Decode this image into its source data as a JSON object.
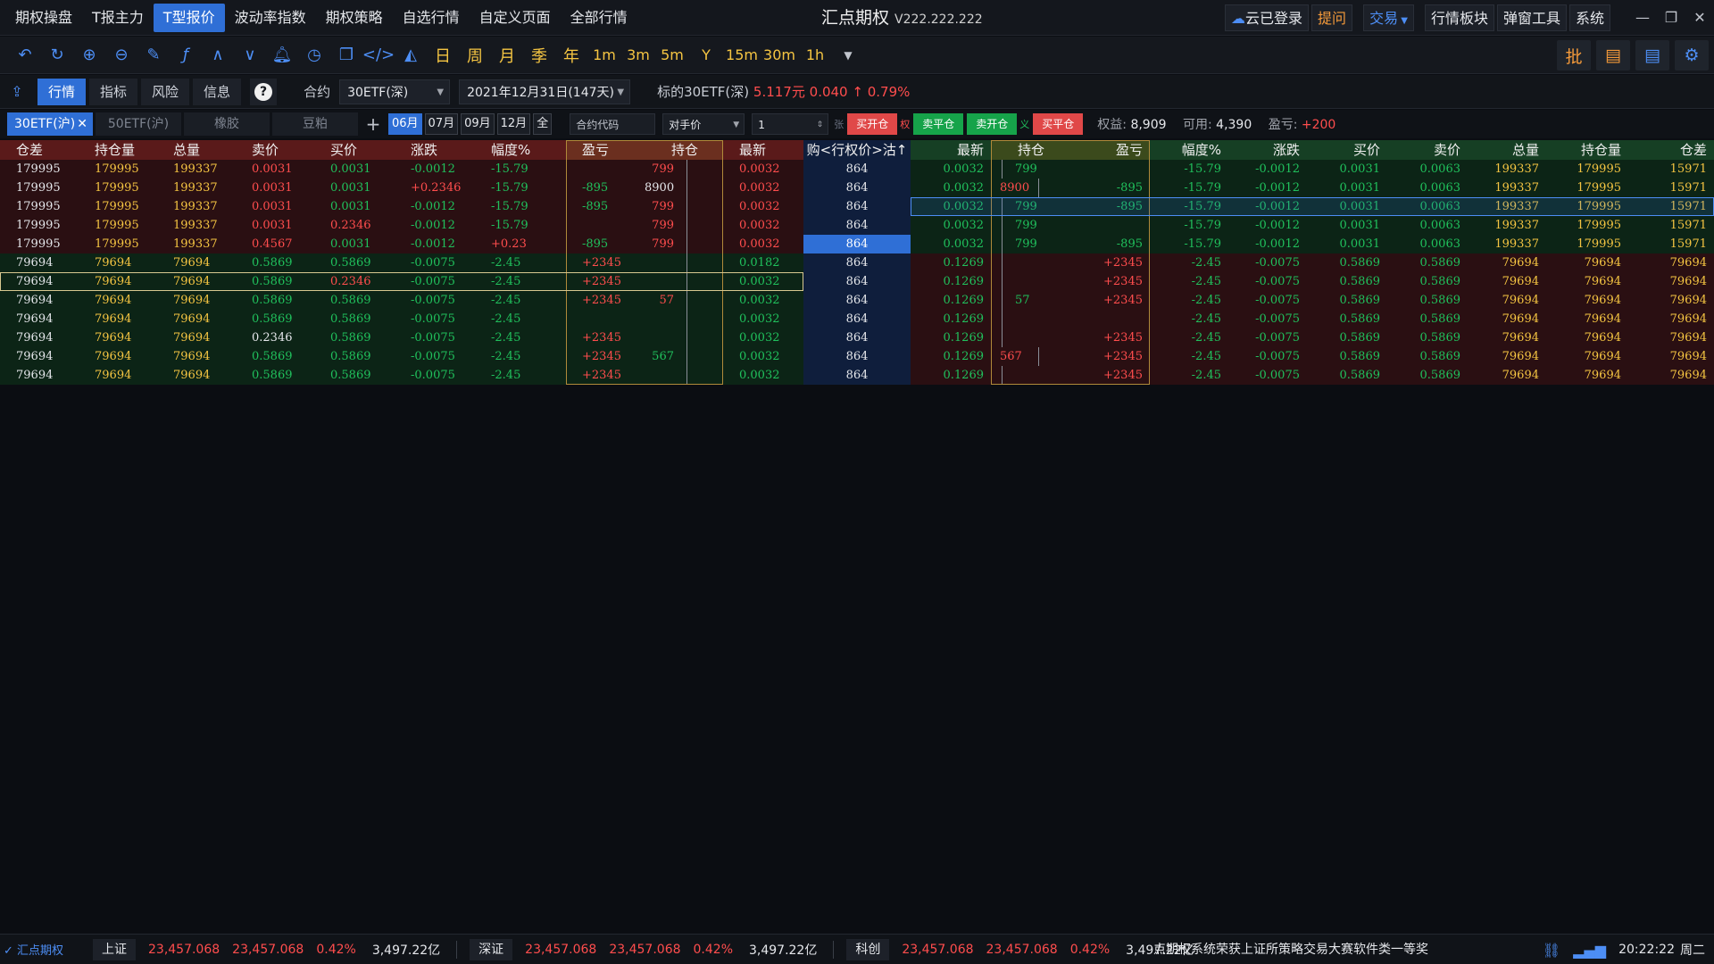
{
  "menu": [
    "期权操盘",
    "T报主力",
    "T型报价",
    "波动率指数",
    "期权策略",
    "自选行情",
    "自定义页面",
    "全部行情"
  ],
  "menu_active": 2,
  "app": {
    "title": "汇点期权",
    "version": "V222.222.222"
  },
  "title_buttons": {
    "cloud": "云已登录",
    "ask": "提问",
    "trade": "交易",
    "board": "行情板块",
    "popup": "弹窗工具",
    "system": "系统"
  },
  "toolbar_text": {
    "day": "日",
    "week": "周",
    "month": "月",
    "quarter": "季",
    "year": "年",
    "m1": "1m",
    "m3": "3m",
    "m5": "5m",
    "y": "Y",
    "m15": "15m",
    "m30": "30m",
    "h1": "1h",
    "batch": "批"
  },
  "infobar": {
    "tabs": [
      "行情",
      "指标",
      "风险",
      "信息"
    ],
    "contract_label": "合约",
    "contract": "30ETF(深)",
    "expiry": "2021年12月31日(147天)",
    "underlying_label": "标的30ETF(深)",
    "price": "5.117元",
    "change": "0.040",
    "pct": "0.79%"
  },
  "filter": {
    "tabs": [
      "30ETF(沪)",
      "50ETF(沪)",
      "橡胶",
      "豆粕"
    ],
    "months": [
      "06月",
      "07月",
      "09月",
      "12月",
      "全"
    ],
    "code_placeholder": "合约代码",
    "price_type": "对手价",
    "qty": "1",
    "unit": "张",
    "btn_buy_open": "买开仓",
    "mark_right": "权",
    "btn_sell_close": "卖平仓",
    "btn_sell_open": "卖开仓",
    "mark_obligation": "义",
    "btn_buy_close": "买平仓",
    "equity_label": "权益:",
    "equity": "8,909",
    "avail_label": "可用:",
    "avail": "4,390",
    "pnl_label": "盈亏:",
    "pnl": "+200"
  },
  "table": {
    "call_headers": [
      "仓差",
      "持仓量",
      "总量",
      "卖价",
      "买价",
      "涨跌",
      "幅度%",
      "盈亏",
      "持仓",
      "最新"
    ],
    "strike_header": "购<行权价>沽",
    "put_headers": [
      "最新",
      "持仓",
      "盈亏",
      "幅度%",
      "涨跌",
      "买价",
      "卖价",
      "总量",
      "持仓量",
      "仓差"
    ],
    "rows": [
      {
        "c": [
          "179995",
          "179995",
          "199337",
          "0.0031",
          "0.0031",
          "-0.0012",
          "-15.79",
          "",
          "799",
          "0.0032"
        ],
        "cc": [
          "w",
          "y",
          "y",
          "r",
          "g",
          "g",
          "g",
          "",
          "r",
          "r"
        ],
        "k": "864",
        "p": [
          "0.0032",
          "799",
          "",
          "-15.79",
          "-0.0012",
          "0.0031",
          "0.0063",
          "199337",
          "179995",
          "15971"
        ],
        "pc": [
          "g",
          "g",
          "",
          "g",
          "g",
          "g",
          "g",
          "y",
          "y",
          "y"
        ]
      },
      {
        "c": [
          "179995",
          "179995",
          "199337",
          "0.0031",
          "0.0031",
          "+0.2346",
          "-15.79",
          "-895",
          "8900",
          "0.0032"
        ],
        "cc": [
          "w",
          "y",
          "y",
          "r",
          "g",
          "r",
          "g",
          "g",
          "w",
          "r"
        ],
        "k": "864",
        "p": [
          "0.0032",
          "8900",
          "-895",
          "-15.79",
          "-0.0012",
          "0.0031",
          "0.0063",
          "199337",
          "179995",
          "15971"
        ],
        "pc": [
          "g",
          "r",
          "g",
          "g",
          "g",
          "g",
          "g",
          "y",
          "y",
          "y"
        ]
      },
      {
        "c": [
          "179995",
          "179995",
          "199337",
          "0.0031",
          "0.0031",
          "-0.0012",
          "-15.79",
          "-895",
          "799",
          "0.0032"
        ],
        "cc": [
          "w",
          "y",
          "y",
          "r",
          "g",
          "g",
          "g",
          "g",
          "r",
          "r"
        ],
        "k": "864",
        "p": [
          "0.0032",
          "799",
          "-895",
          "-15.79",
          "-0.0012",
          "0.0031",
          "0.0063",
          "199337",
          "179995",
          "15971"
        ],
        "pc": [
          "g",
          "g",
          "g",
          "g",
          "g",
          "g",
          "g",
          "y",
          "y",
          "y"
        ]
      },
      {
        "c": [
          "179995",
          "179995",
          "199337",
          "0.0031",
          "0.2346",
          "-0.0012",
          "-15.79",
          "",
          "799",
          "0.0032"
        ],
        "cc": [
          "w",
          "y",
          "y",
          "r",
          "r",
          "g",
          "g",
          "",
          "r",
          "r"
        ],
        "k": "864",
        "p": [
          "0.0032",
          "799",
          "",
          "-15.79",
          "-0.0012",
          "0.0031",
          "0.0063",
          "199337",
          "179995",
          "15971"
        ],
        "pc": [
          "g",
          "g",
          "",
          "g",
          "g",
          "g",
          "g",
          "y",
          "y",
          "y"
        ]
      },
      {
        "c": [
          "179995",
          "179995",
          "199337",
          "0.4567",
          "0.0031",
          "-0.0012",
          "+0.23",
          "-895",
          "799",
          "0.0032"
        ],
        "cc": [
          "w",
          "y",
          "y",
          "r",
          "g",
          "g",
          "r",
          "g",
          "r",
          "r"
        ],
        "k": "864",
        "p": [
          "0.0032",
          "799",
          "-895",
          "-15.79",
          "-0.0012",
          "0.0031",
          "0.0063",
          "199337",
          "179995",
          "15971"
        ],
        "pc": [
          "g",
          "g",
          "g",
          "g",
          "g",
          "g",
          "g",
          "y",
          "y",
          "y"
        ]
      },
      {
        "c": [
          "79694",
          "79694",
          "79694",
          "0.5869",
          "0.5869",
          "-0.0075",
          "-2.45",
          "+2345",
          "",
          "0.0182"
        ],
        "cc": [
          "w",
          "y",
          "y",
          "g",
          "g",
          "g",
          "g",
          "r",
          "",
          "g"
        ],
        "k": "864",
        "p": [
          "0.1269",
          "",
          "+2345",
          "-2.45",
          "-0.0075",
          "0.5869",
          "0.5869",
          "79694",
          "79694",
          "79694"
        ],
        "pc": [
          "g",
          "",
          "r",
          "g",
          "g",
          "g",
          "g",
          "y",
          "y",
          "y"
        ]
      },
      {
        "c": [
          "79694",
          "79694",
          "79694",
          "0.5869",
          "0.2346",
          "-0.0075",
          "-2.45",
          "+2345",
          "",
          "0.0032"
        ],
        "cc": [
          "w",
          "y",
          "y",
          "g",
          "r",
          "g",
          "g",
          "r",
          "",
          "g"
        ],
        "k": "864",
        "p": [
          "0.1269",
          "",
          "+2345",
          "-2.45",
          "-0.0075",
          "0.5869",
          "0.5869",
          "79694",
          "79694",
          "79694"
        ],
        "pc": [
          "g",
          "",
          "r",
          "g",
          "g",
          "g",
          "g",
          "y",
          "y",
          "y"
        ]
      },
      {
        "c": [
          "79694",
          "79694",
          "79694",
          "0.5869",
          "0.5869",
          "-0.0075",
          "-2.45",
          "+2345",
          "57",
          "0.0032"
        ],
        "cc": [
          "w",
          "y",
          "y",
          "g",
          "g",
          "g",
          "g",
          "r",
          "r",
          "g"
        ],
        "k": "864",
        "p": [
          "0.1269",
          "57",
          "+2345",
          "-2.45",
          "-0.0075",
          "0.5869",
          "0.5869",
          "79694",
          "79694",
          "79694"
        ],
        "pc": [
          "g",
          "g",
          "r",
          "g",
          "g",
          "g",
          "g",
          "y",
          "y",
          "y"
        ]
      },
      {
        "c": [
          "79694",
          "79694",
          "79694",
          "0.5869",
          "0.5869",
          "-0.0075",
          "-2.45",
          "",
          "",
          "0.0032"
        ],
        "cc": [
          "w",
          "y",
          "y",
          "g",
          "g",
          "g",
          "g",
          "",
          "",
          "g"
        ],
        "k": "864",
        "p": [
          "0.1269",
          "",
          "",
          "-2.45",
          "-0.0075",
          "0.5869",
          "0.5869",
          "79694",
          "79694",
          "79694"
        ],
        "pc": [
          "g",
          "",
          "",
          "g",
          "g",
          "g",
          "g",
          "y",
          "y",
          "y"
        ]
      },
      {
        "c": [
          "79694",
          "79694",
          "79694",
          "0.2346",
          "0.5869",
          "-0.0075",
          "-2.45",
          "+2345",
          "",
          "0.0032"
        ],
        "cc": [
          "w",
          "y",
          "y",
          "w",
          "g",
          "g",
          "g",
          "r",
          "",
          "g"
        ],
        "k": "864",
        "p": [
          "0.1269",
          "",
          "+2345",
          "-2.45",
          "-0.0075",
          "0.5869",
          "0.5869",
          "79694",
          "79694",
          "79694"
        ],
        "pc": [
          "g",
          "",
          "r",
          "g",
          "g",
          "g",
          "g",
          "y",
          "y",
          "y"
        ]
      },
      {
        "c": [
          "79694",
          "79694",
          "79694",
          "0.5869",
          "0.5869",
          "-0.0075",
          "-2.45",
          "+2345",
          "567",
          "0.0032"
        ],
        "cc": [
          "w",
          "y",
          "y",
          "g",
          "g",
          "g",
          "g",
          "r",
          "g",
          "g"
        ],
        "k": "864",
        "p": [
          "0.1269",
          "567",
          "+2345",
          "-2.45",
          "-0.0075",
          "0.5869",
          "0.5869",
          "79694",
          "79694",
          "79694"
        ],
        "pc": [
          "g",
          "r",
          "r",
          "g",
          "g",
          "g",
          "g",
          "y",
          "y",
          "y"
        ]
      },
      {
        "c": [
          "79694",
          "79694",
          "79694",
          "0.5869",
          "0.5869",
          "-0.0075",
          "-2.45",
          "+2345",
          "",
          "0.0032"
        ],
        "cc": [
          "w",
          "y",
          "y",
          "g",
          "g",
          "g",
          "g",
          "r",
          "",
          "g"
        ],
        "k": "864",
        "p": [
          "0.1269",
          "",
          "+2345",
          "-2.45",
          "-0.0075",
          "0.5869",
          "0.5869",
          "79694",
          "79694",
          "79694"
        ],
        "pc": [
          "g",
          "",
          "r",
          "g",
          "g",
          "g",
          "g",
          "y",
          "y",
          "y"
        ]
      }
    ],
    "selected_strike_row": 4,
    "selected_call_row": 6,
    "selected_put_row": 2
  },
  "statusbar": {
    "logo": "汇点期权",
    "markets": [
      {
        "name": "上证",
        "v1": "23,457.068",
        "v2": "23,457.068",
        "pct": "0.42%",
        "amt": "3,497.22亿"
      },
      {
        "name": "深证",
        "v1": "23,457.068",
        "v2": "23,457.068",
        "pct": "0.42%",
        "amt": "3,497.22亿"
      },
      {
        "name": "科创",
        "v1": "23,457.068",
        "v2": "23,457.068",
        "pct": "0.42%",
        "amt": "3,497.22亿"
      }
    ],
    "news": "点期权系统荣获上证所策略交易大赛软件类一等奖",
    "time": "20:22:22",
    "weekday": "周二"
  },
  "colors": {
    "accent": "#2f6fd6",
    "up": "#ff4d4d",
    "down": "#20c05c",
    "volume": "#f5c542"
  }
}
